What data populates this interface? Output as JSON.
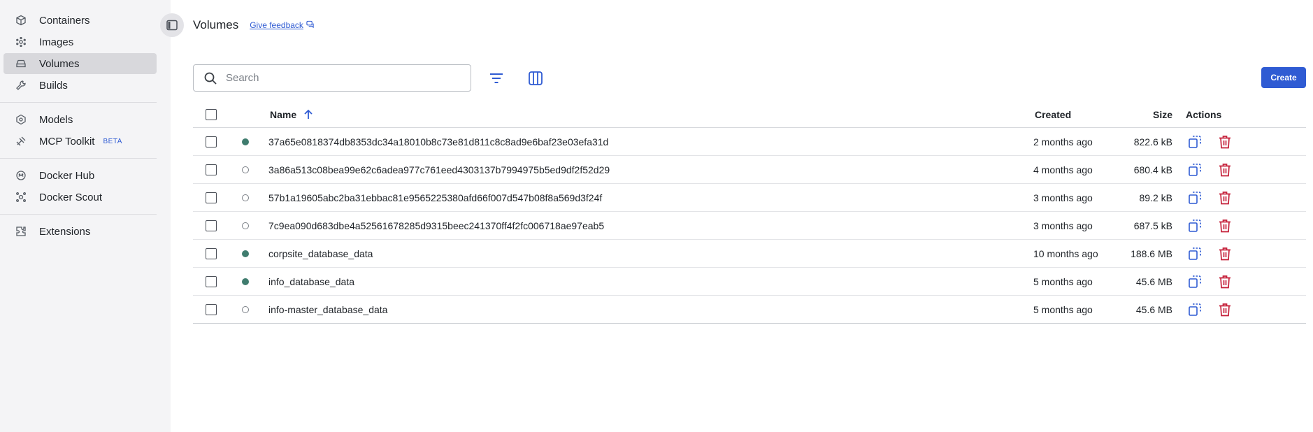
{
  "sidebar": {
    "items": [
      {
        "label": "Containers",
        "icon": "containers-icon"
      },
      {
        "label": "Images",
        "icon": "images-icon"
      },
      {
        "label": "Volumes",
        "icon": "volumes-icon",
        "active": true
      },
      {
        "label": "Builds",
        "icon": "builds-icon"
      },
      {
        "label": "Models",
        "icon": "models-icon"
      },
      {
        "label": "MCP Toolkit",
        "icon": "mcp-toolkit-icon",
        "badge": "BETA"
      },
      {
        "label": "Docker Hub",
        "icon": "docker-hub-icon"
      },
      {
        "label": "Docker Scout",
        "icon": "docker-scout-icon"
      },
      {
        "label": "Extensions",
        "icon": "extensions-icon"
      }
    ]
  },
  "header": {
    "title": "Volumes",
    "feedback_label": "Give feedback"
  },
  "toolbar": {
    "search_placeholder": "Search",
    "create_label": "Create"
  },
  "table": {
    "columns": {
      "name": "Name",
      "created": "Created",
      "size": "Size",
      "actions": "Actions"
    },
    "rows": [
      {
        "in_use": true,
        "name": "37a65e0818374db8353dc34a18010b8c73e81d811c8c8ad9e6baf23e03efa31d",
        "created": "2 months ago",
        "size": "822.6 kB"
      },
      {
        "in_use": false,
        "name": "3a86a513c08bea99e62c6adea977c761eed4303137b7994975b5ed9df2f52d29",
        "created": "4 months ago",
        "size": "680.4 kB"
      },
      {
        "in_use": false,
        "name": "57b1a19605abc2ba31ebbac81e9565225380afd66f007d547b08f8a569d3f24f",
        "created": "3 months ago",
        "size": "89.2 kB"
      },
      {
        "in_use": false,
        "name": "7c9ea090d683dbe4a52561678285d9315beec241370ff4f2fc006718ae97eab5",
        "created": "3 months ago",
        "size": "687.5 kB"
      },
      {
        "in_use": true,
        "name": "corpsite_database_data",
        "created": "10 months ago",
        "size": "188.6 MB"
      },
      {
        "in_use": true,
        "name": "info_database_data",
        "created": "5 months ago",
        "size": "45.6 MB"
      },
      {
        "in_use": false,
        "name": "info-master_database_data",
        "created": "5 months ago",
        "size": "45.6 MB"
      }
    ]
  },
  "colors": {
    "accent": "#2f5bd3",
    "in_use": "#3f7c6e",
    "delete": "#c5203a",
    "sidebar_bg": "#f4f4f6",
    "sidebar_active": "#d8d8dc"
  }
}
